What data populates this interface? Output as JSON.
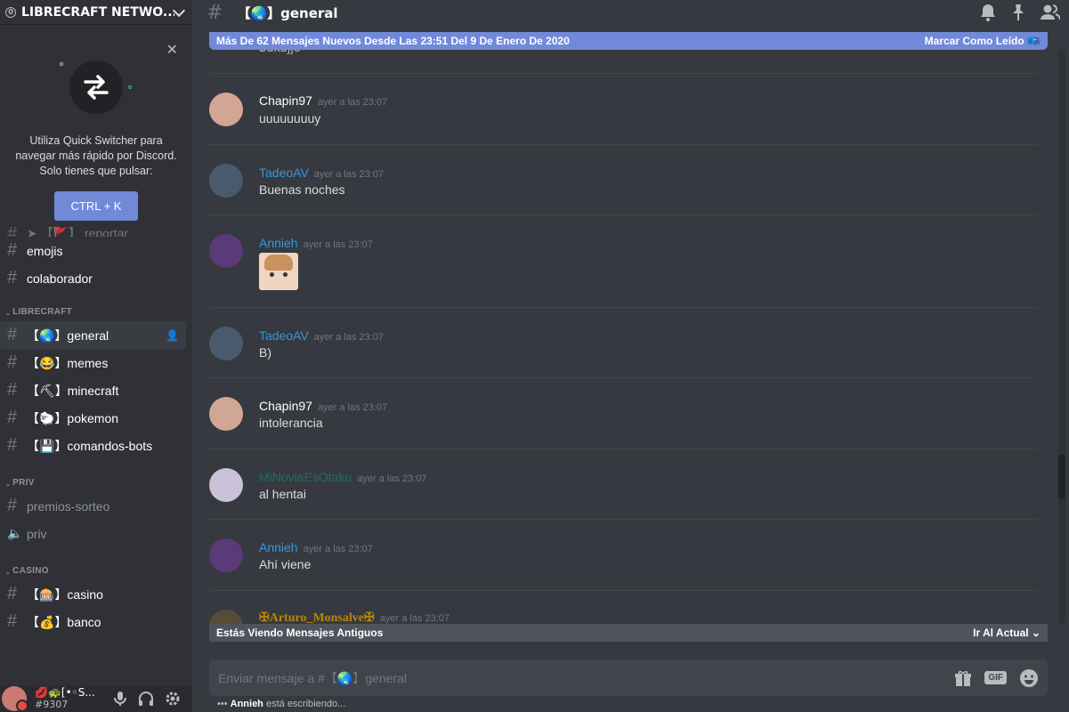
{
  "server": {
    "badge": "0",
    "name": "LIBRECRAFT NETWO..."
  },
  "quick_switcher": {
    "close": "✕",
    "text": "Utiliza Quick Switcher para navegar más rápido por Discord. Solo tienes que pulsar:",
    "shortcut": "CTRL + K"
  },
  "channels_top": [
    {
      "name": "➤ 【🚩】 reportar"
    },
    {
      "name": "emojis"
    },
    {
      "name": "colaborador"
    }
  ],
  "categories": [
    {
      "name": "LIBRECRAFT",
      "channels": [
        {
          "name": "【🌏】general",
          "active": true
        },
        {
          "name": "【😂】memes"
        },
        {
          "name": "【⛏】minecraft"
        },
        {
          "name": "【🐑】pokemon"
        },
        {
          "name": "【💾】comandos-bots"
        }
      ]
    },
    {
      "name": "PRIV",
      "channels": [
        {
          "name": "premios-sorteo"
        },
        {
          "name": "priv",
          "icon": "speaker"
        }
      ]
    },
    {
      "name": "CASINO",
      "channels": [
        {
          "name": "【🎰】casino"
        },
        {
          "name": "【💰】banco"
        }
      ]
    }
  ],
  "user": {
    "name": "💋🐢[•◦S...",
    "tag": "#9307"
  },
  "channel": {
    "hash": "#",
    "name": "【🌏】general"
  },
  "new_messages_bar": {
    "text": "Más De 62 Mensajes Nuevos Desde Las 23:51 Del 9 De Enero De 2020",
    "action": "Marcar Como Leído"
  },
  "messages": [
    {
      "author": "Chapin97",
      "time": "ayer a las 23:07",
      "content": "uuuuuuuuy",
      "color": "#ffffff",
      "avatar_color": "#d2a694"
    },
    {
      "author": "TadeoAV",
      "time": "ayer a las 23:07",
      "content": "Buenas noches",
      "color": "#3498db",
      "avatar_color": "#4a5a6e"
    },
    {
      "author": "Annieh",
      "time": "ayer a las 23:07",
      "content": "",
      "sticker": true,
      "color": "#3498db",
      "avatar_color": "#5b3a7a"
    },
    {
      "author": "TadeoAV",
      "time": "ayer a las 23:07",
      "content": "B)",
      "color": "#3498db",
      "avatar_color": "#4a5a6e"
    },
    {
      "author": "Chapin97",
      "time": "ayer a las 23:07",
      "content": "intolerancia",
      "color": "#ffffff",
      "avatar_color": "#d2a694"
    },
    {
      "author": "MiNoviaEsOtaku",
      "time": "ayer a las 23:07",
      "content": "al hentai",
      "color": "#1f6b6b",
      "avatar_color": "#c9c2d8"
    },
    {
      "author": "Annieh",
      "time": "ayer a las 23:07",
      "content": "Ahí viene",
      "color": "#3498db",
      "avatar_color": "#5b3a7a"
    },
    {
      "author": "✠Arturo_Monsalve✠",
      "time": "ayer a las 23:07",
      "content": "",
      "color": "#b8860b",
      "avatar_color": "#5a4a3a"
    }
  ],
  "old_messages_bar": {
    "text": "Estás Viendo Mensajes Antiguos",
    "action": "Ir Al Actual"
  },
  "composer": {
    "placeholder": "Enviar mensaje a #【🌏】general",
    "gif": "GIF"
  },
  "typing": {
    "user": "Annieh",
    "text": "está escribiendo..."
  }
}
